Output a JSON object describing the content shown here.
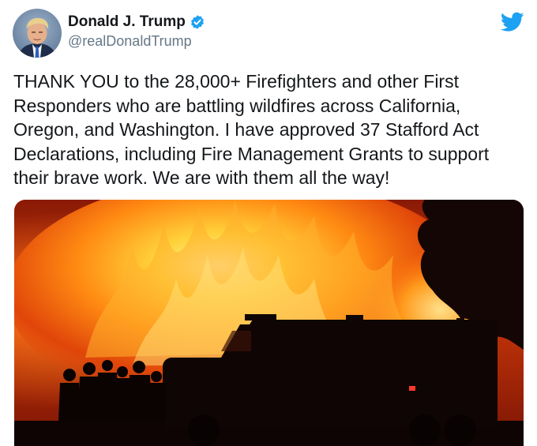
{
  "tweet": {
    "author": {
      "display_name": "Donald J. Trump",
      "handle": "@realDonaldTrump",
      "verified": true,
      "avatar_icon": "profile-photo"
    },
    "text": "THANK YOU to the 28,000+ Firefighters and other First\nResponders who are battling wildfires across California,\nOregon, and Washington. I have approved 37 Stafford Act\nDeclarations, including Fire Management Grants to support\ntheir brave work. We are with them all the way!",
    "media": {
      "type": "photo",
      "icon": "wildfire-photo"
    }
  },
  "icons": {
    "verified": "verified-badge-icon",
    "brand": "twitter-bird-icon"
  },
  "colors": {
    "brand_blue": "#1da1f2",
    "name_text": "#14171a",
    "handle_text": "#657786"
  }
}
